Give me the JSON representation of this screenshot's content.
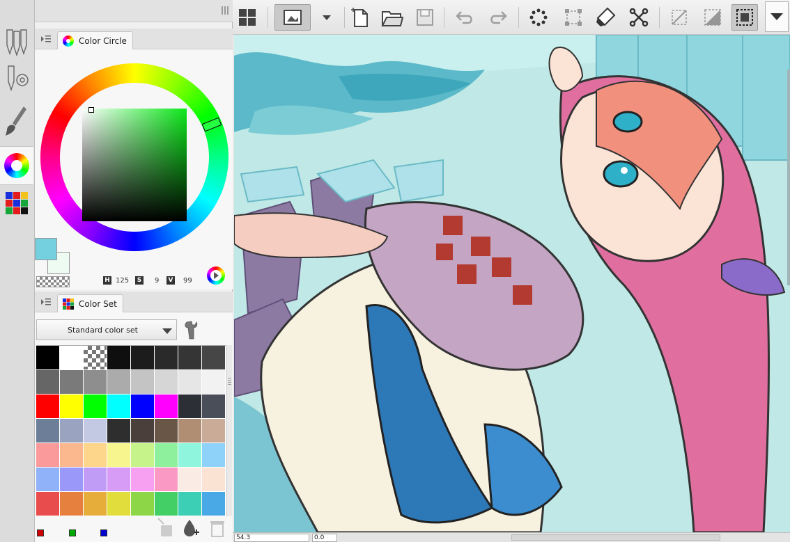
{
  "left_toolstrip": {
    "tools": [
      {
        "name": "pen-tools-icon"
      },
      {
        "name": "brush-settings-icon"
      },
      {
        "name": "paintbrush-icon"
      },
      {
        "name": "color-wheel-icon",
        "active": true
      },
      {
        "name": "color-set-icon"
      }
    ]
  },
  "color_circle_panel": {
    "tab_label": "Color Circle",
    "main_color": "#74cfdf",
    "sub_color": "#edfbf2",
    "hue_label": "H",
    "hue_value": "125",
    "sat_label": "S",
    "sat_value": "9",
    "val_label": "V",
    "val_value": "99"
  },
  "color_set_panel": {
    "tab_label": "Color Set",
    "selected_set": "Standard color set",
    "swatches": [
      "#000000",
      "#ffffff",
      "checker",
      "#0f0f0f",
      "#1c1c1c",
      "#2a2a2a",
      "#353535",
      "#464646",
      "#666666",
      "#7a7a7a",
      "#8e8e8e",
      "#ababab",
      "#c4c4c4",
      "#d6d6d6",
      "#e6e6e6",
      "#f2f2f2",
      "#ff0000",
      "#ffff00",
      "#00ff00",
      "#00ffff",
      "#0000ff",
      "#ff00ff",
      "#2c2f36",
      "#4a4e58",
      "#6d7f98",
      "#9aa4c0",
      "#c3c9e2",
      "#2e2e2e",
      "#4a3f3a",
      "#6a5646",
      "#b08e74",
      "#c9ab98",
      "#fa9a9a",
      "#fbb88e",
      "#fdd68c",
      "#f6f58e",
      "#c6f48a",
      "#8ef09c",
      "#8ff6dd",
      "#8ed2fa",
      "#8fb2f8",
      "#9a98f9",
      "#c09cf6",
      "#d79cf5",
      "#f79ff1",
      "#fa9ac4",
      "#faece4",
      "#fbe3d4",
      "#e84c4c",
      "#e6803e",
      "#e6ad3a",
      "#e0dd3c",
      "#8cd648",
      "#44cf66",
      "#3ccfb5",
      "#48a9e6"
    ],
    "footer_colors": [
      "#cc0000",
      "#00aa00",
      "#0000cc"
    ]
  },
  "commandbar": {
    "buttons": [
      {
        "name": "panel-layout-icon"
      },
      {
        "name": "canvas-view-icon",
        "pressed": true
      },
      {
        "name": "view-dropdown-icon"
      },
      {
        "name": "new-file-icon"
      },
      {
        "name": "open-folder-icon"
      },
      {
        "name": "save-icon",
        "dim": true
      },
      {
        "name": "undo-icon",
        "dim": true
      },
      {
        "name": "redo-icon",
        "dim": true
      },
      {
        "name": "loading-spinner-icon"
      },
      {
        "name": "transform-selection-icon",
        "dim": true
      },
      {
        "name": "fill-bucket-icon"
      },
      {
        "name": "expand-selection-icon"
      },
      {
        "name": "clear-selection-icon",
        "dim": true
      },
      {
        "name": "invert-selection-icon",
        "dim": true
      },
      {
        "name": "show-selection-icon",
        "pressed": true
      }
    ]
  },
  "statusbar": {
    "zoom": "54.3",
    "rotation": "0.0"
  }
}
